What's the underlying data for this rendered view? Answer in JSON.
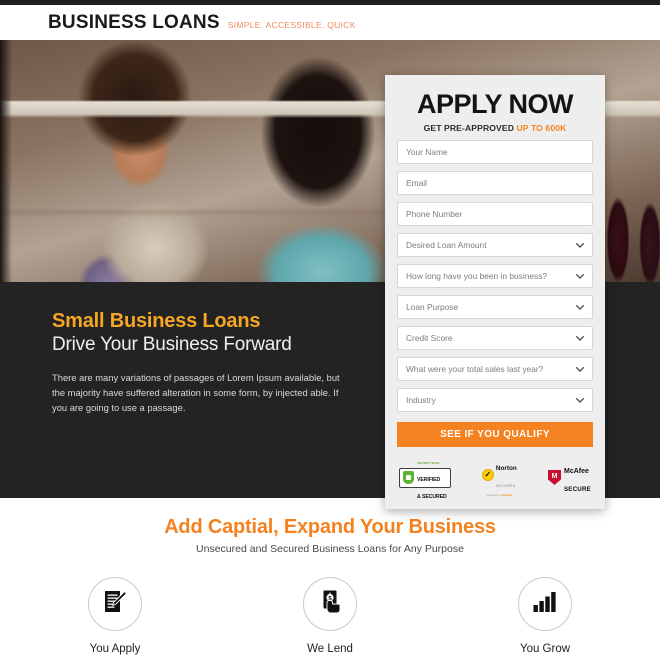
{
  "header": {
    "logo_main": "BUSINESS LOANS",
    "logo_tagline": "SIMPLE. ACCESSIBLE. QUICK"
  },
  "hero": {
    "alt": "two smiling women in a shop"
  },
  "form": {
    "title": "APPLY NOW",
    "subtitle_prefix": "GET PRE-APPROVED ",
    "subtitle_highlight": "UP TO 600K",
    "fields": [
      {
        "name": "your-name-field",
        "placeholder": "Your Name",
        "type": "text"
      },
      {
        "name": "email-field",
        "placeholder": "Email",
        "type": "text"
      },
      {
        "name": "phone-number-field",
        "placeholder": "Phone Number",
        "type": "text"
      }
    ],
    "selects": [
      {
        "name": "desired-loan-amount-select",
        "value": "Desired Loan Amount"
      },
      {
        "name": "time-in-business-select",
        "value": "How long have you been in business?"
      },
      {
        "name": "loan-purpose-select",
        "value": "Loan Purpose"
      },
      {
        "name": "credit-score-select",
        "value": "Credit Score"
      },
      {
        "name": "total-sales-select",
        "value": "What were your total sales last year?"
      },
      {
        "name": "industry-select",
        "value": "Industry"
      }
    ],
    "cta_label": "SEE IF YOU QUALIFY",
    "badges": {
      "verified": {
        "top": "SECURITY SCAN",
        "line1": "VERIFIED",
        "line2": "& SECURED"
      },
      "norton": {
        "name": "Norton",
        "sub": "SECURED",
        "powered": "powered by ",
        "brand": "verisign"
      },
      "mcafee": {
        "line1": "McAfee",
        "line2": "SECURE"
      }
    }
  },
  "pitch": {
    "heading_orange": "Small Business Loans",
    "heading_white": "Drive Your Business Forward",
    "body": "There are many variations of passages of Lorem Ipsum available, but the majority have suffered alteration in some form, by injected able. If you are going to use a passage."
  },
  "benefits": {
    "title": "Add Captial, Expand Your Business",
    "subtitle": "Unsecured and Secured Business Loans for Any Purpose",
    "steps": [
      {
        "icon": "document-pencil-icon",
        "label": "You Apply"
      },
      {
        "icon": "hand-cash-icon",
        "label": "We Lend"
      },
      {
        "icon": "bar-chart-icon",
        "label": "You Grow"
      }
    ]
  },
  "colors": {
    "accent_orange": "#f58220",
    "heading_orange": "#f5a623",
    "tagline": "#f08a5d",
    "dark_section": "#232323"
  }
}
